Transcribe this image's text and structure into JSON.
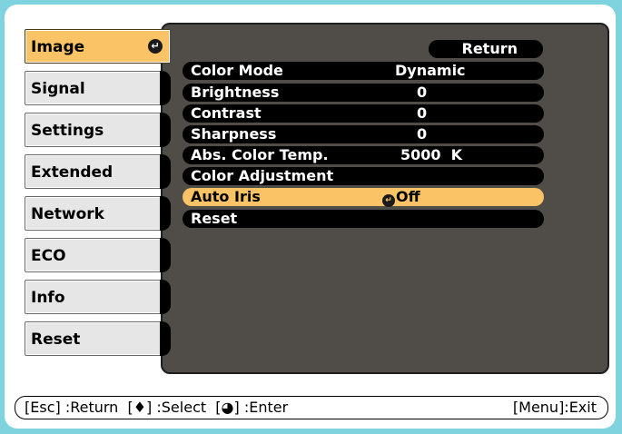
{
  "tabs": [
    {
      "label": "Image",
      "active": true
    },
    {
      "label": "Signal",
      "active": false
    },
    {
      "label": "Settings",
      "active": false
    },
    {
      "label": "Extended",
      "active": false
    },
    {
      "label": "Network",
      "active": false
    },
    {
      "label": "ECO",
      "active": false
    },
    {
      "label": "Info",
      "active": false
    },
    {
      "label": "Reset",
      "active": false
    }
  ],
  "return_label": "Return",
  "menu_rows": [
    {
      "label": "Color Mode",
      "value": "Dynamic"
    },
    {
      "label": "Brightness",
      "value": "0"
    },
    {
      "label": "Contrast",
      "value": "0"
    },
    {
      "label": "Sharpness",
      "value": "0"
    },
    {
      "label": "Abs. Color Temp.",
      "value": "5000  K"
    },
    {
      "label": "Color Adjustment",
      "value": ""
    },
    {
      "label": "Auto Iris",
      "value": "Off",
      "selected": true
    },
    {
      "label": "Reset",
      "value": ""
    }
  ],
  "help": {
    "left": "[Esc] :Return  [♦] :Select  [◕] :Enter",
    "right": "[Menu]:Exit"
  },
  "colors": {
    "accent": "#f9c366",
    "panel": "#504c48",
    "background": "#7fd3de"
  }
}
